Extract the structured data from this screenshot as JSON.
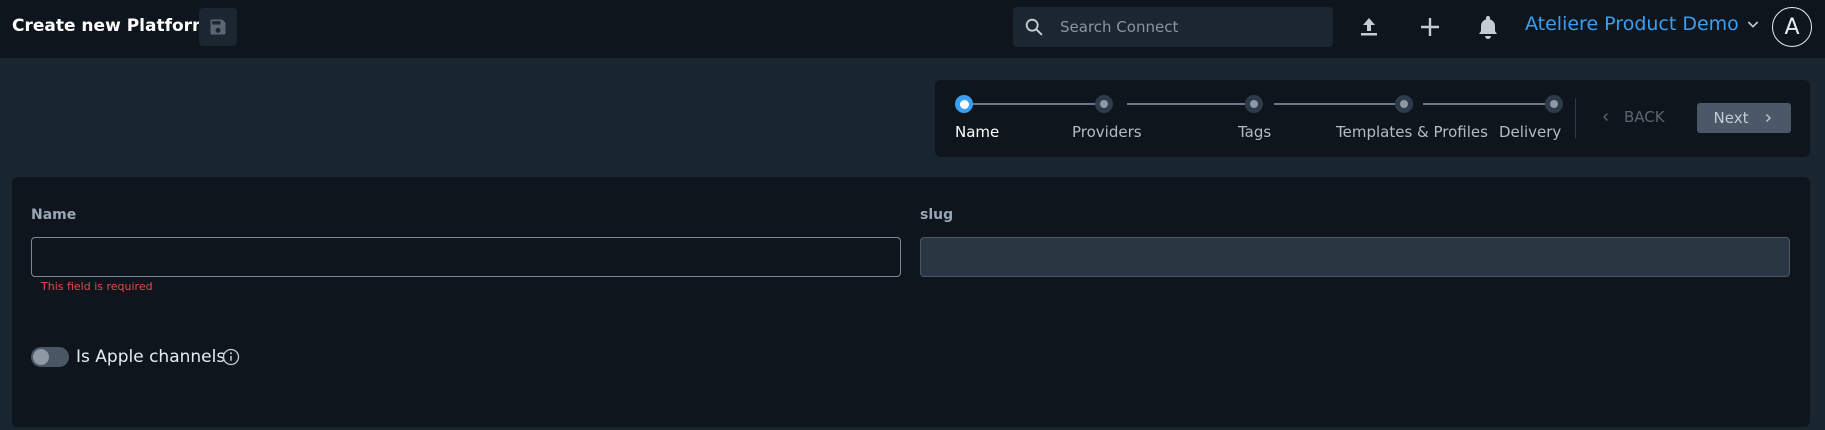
{
  "header": {
    "title": "Create new Platform",
    "save_icon": "save-icon",
    "search": {
      "placeholder": "Search Connect",
      "value": ""
    },
    "org_name": "Ateliere Product Demo",
    "avatar_initial": "A"
  },
  "stepper": {
    "steps": [
      {
        "label": "Name",
        "active": true
      },
      {
        "label": "Providers",
        "active": false
      },
      {
        "label": "Tags",
        "active": false
      },
      {
        "label": "Templates & Profiles",
        "active": false
      },
      {
        "label": "Delivery",
        "active": false
      }
    ],
    "back_label": "BACK",
    "next_label": "Next"
  },
  "form": {
    "name_label": "Name",
    "name_value": "",
    "name_error": "This field is required",
    "slug_label": "slug",
    "slug_value": "",
    "apple_toggle_label": "Is Apple channels",
    "apple_toggle_on": false
  },
  "colors": {
    "accent": "#3a9ff0",
    "error": "#e24c4c",
    "header_bg": "#0e151c",
    "page_bg": "#19262f"
  }
}
